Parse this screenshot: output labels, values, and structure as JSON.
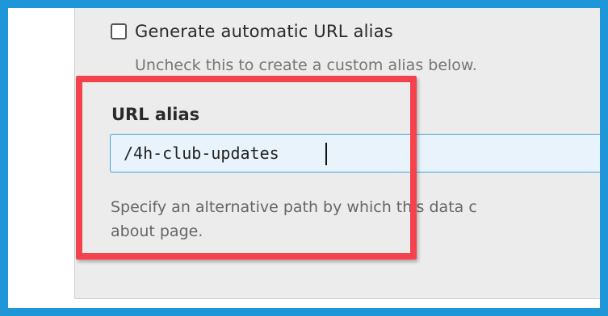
{
  "automatic_alias": {
    "checkbox_label": "Generate automatic URL alias",
    "checked": false,
    "description": "Uncheck this to create a custom alias below."
  },
  "url_alias": {
    "label": "URL alias",
    "value": "/4h-club-updates",
    "description_line1": "Specify an alternative path by which this data c",
    "description_line2": "about page."
  },
  "colors": {
    "frame_border": "#1e96d8",
    "highlight_border": "#f4434c",
    "input_border": "#40a0dc",
    "input_background": "#e9f3fc",
    "panel_background": "#ececec"
  }
}
